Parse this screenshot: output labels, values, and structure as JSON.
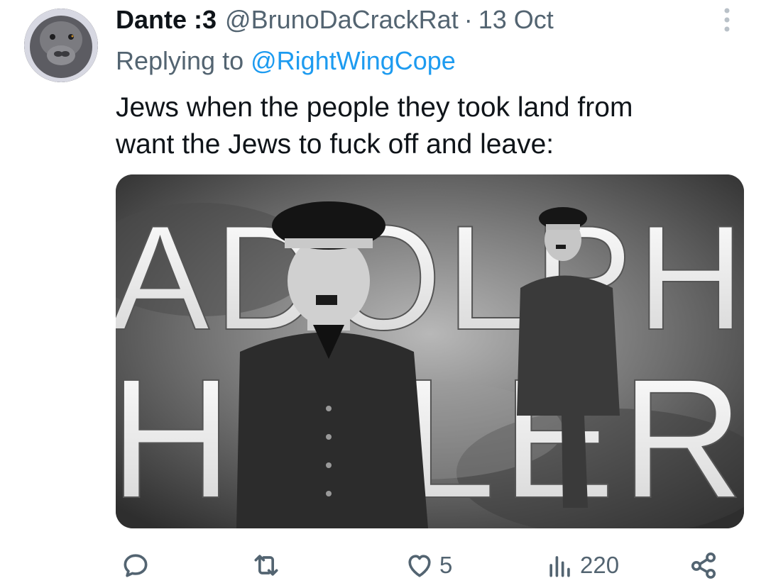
{
  "author": {
    "display_name": "Dante :3",
    "handle": "@BrunoDaCrackRat",
    "separator": "·",
    "date": "13 Oct"
  },
  "reply": {
    "prefix": "Replying to",
    "mention": "@RightWingCope"
  },
  "tweet": {
    "lines": [
      "Jews when the people they took land from",
      "want the Jews to fuck off and leave:"
    ]
  },
  "media": {
    "title_top": "ADOLPH",
    "title_bottom": "HITLER"
  },
  "actions": {
    "reply_count": "",
    "retweet_count": "",
    "like_count": "5",
    "views_count": "220"
  },
  "icons": {
    "reply": "reply-icon",
    "retweet": "retweet-icon",
    "like": "heart-icon",
    "views": "views-icon",
    "share": "share-icon",
    "more": "more-icon"
  },
  "colors": {
    "text": "#0f1419",
    "secondary": "#536471",
    "link": "#1d9bf0"
  }
}
